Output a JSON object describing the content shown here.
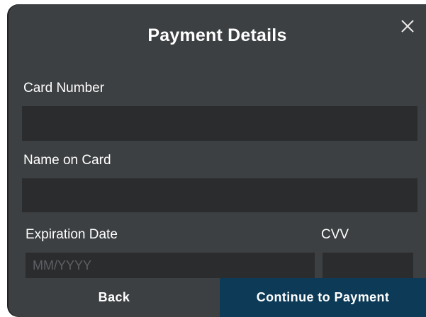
{
  "dialog": {
    "title": "Payment Details",
    "close_icon": "close-icon"
  },
  "fields": {
    "card_number": {
      "label": "Card Number",
      "value": "",
      "placeholder": ""
    },
    "name_on_card": {
      "label": "Name on Card",
      "value": "",
      "placeholder": ""
    },
    "expiration_date": {
      "label": "Expiration Date",
      "value": "",
      "placeholder": "MM/YYYY"
    },
    "cvv": {
      "label": "CVV",
      "value": "",
      "placeholder": ""
    }
  },
  "footer": {
    "back_label": "Back",
    "continue_label": "Continue to Payment"
  },
  "colors": {
    "dialog_background": "#3d4042",
    "input_background": "#2b2c2e",
    "primary_button": "#0d3a57",
    "text": "#ffffff"
  }
}
